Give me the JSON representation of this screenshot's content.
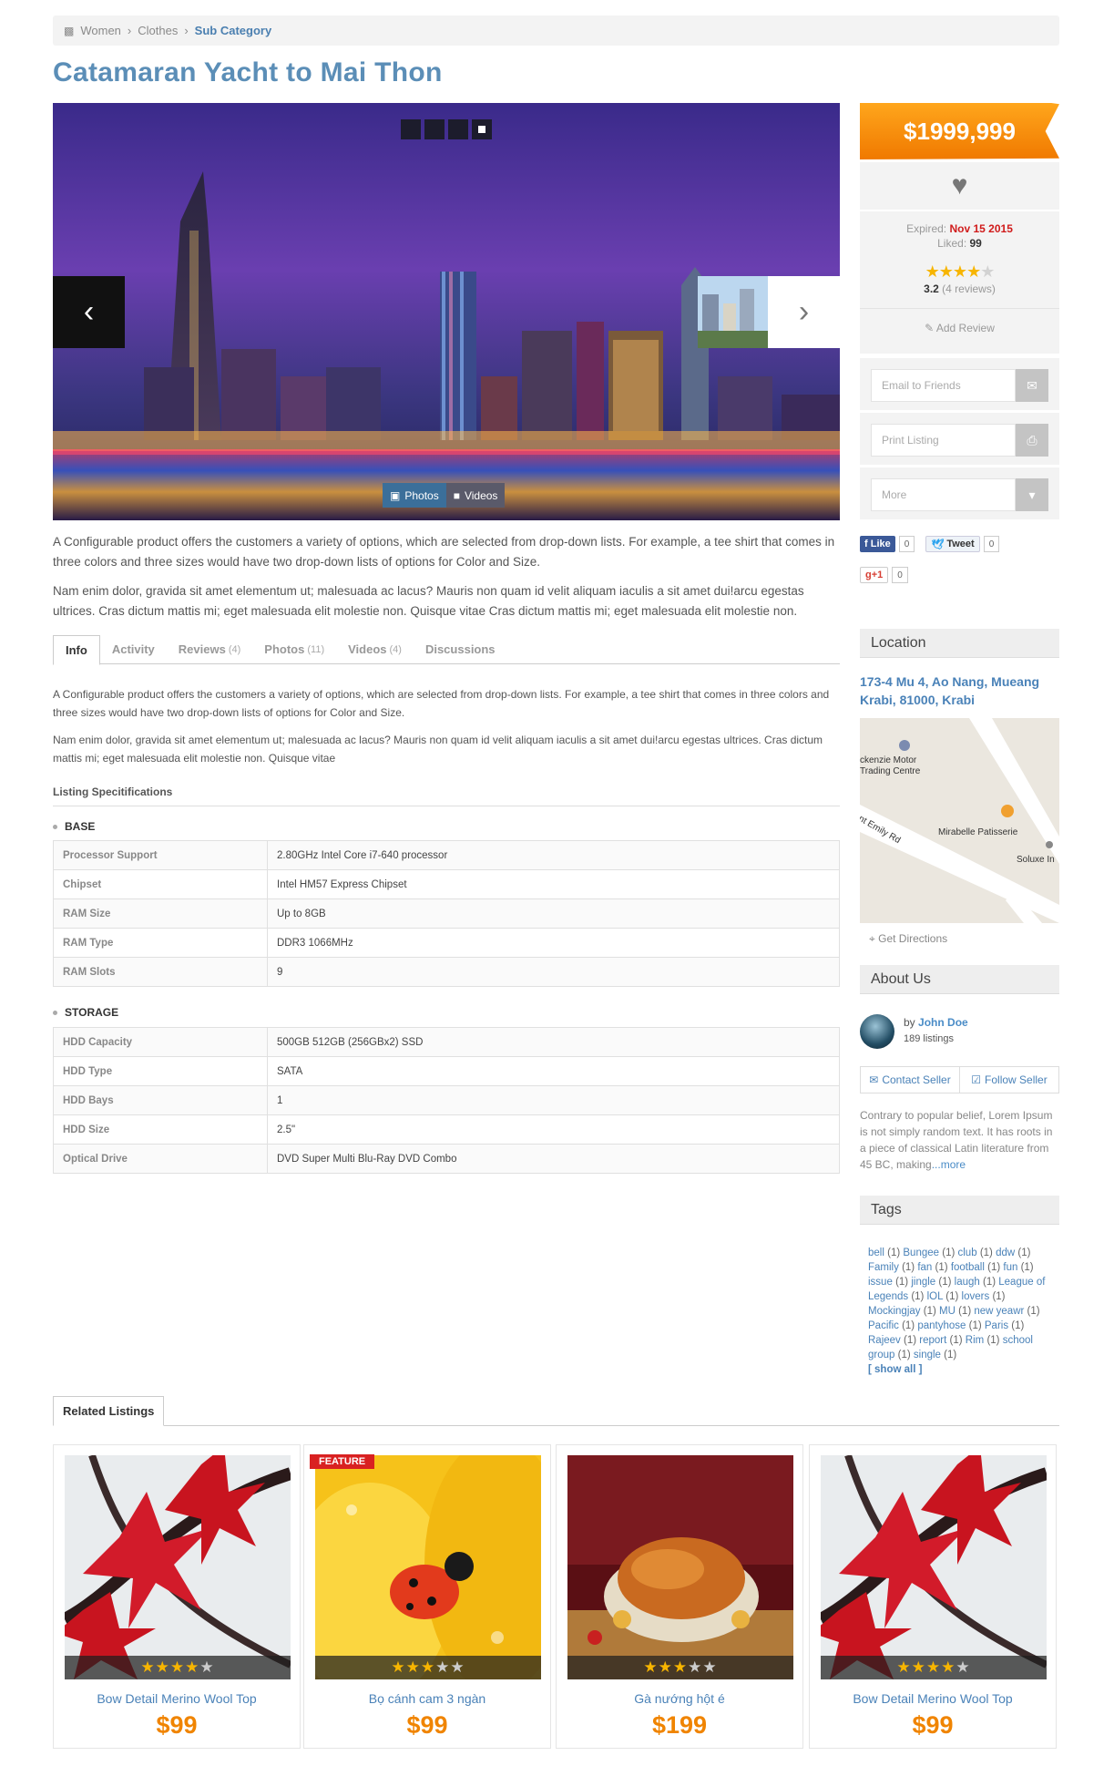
{
  "breadcrumb": {
    "items": [
      "Women",
      "Clothes"
    ],
    "current": "Sub Category"
  },
  "listing": {
    "title": "Catamaran Yacht to Mai Thon",
    "price": "$1999,999",
    "expired_label": "Expired:",
    "expired_value": "Nov 15 2015",
    "liked_label": "Liked:",
    "liked_value": "99",
    "rating": 3.2,
    "rating_text": "3.2",
    "reviews_text": "(4 reviews)",
    "add_review": "Add Review"
  },
  "slider": {
    "tabs": [
      {
        "label": "Photos",
        "icon": "photo-icon"
      },
      {
        "label": "Videos",
        "icon": "video-icon"
      }
    ]
  },
  "description": [
    "A Configurable product offers the customers a variety of options, which are selected from drop-down lists. For example, a tee shirt that comes in three colors and three sizes would have two drop-down lists of options for Color and Size.",
    "Nam enim dolor, gravida sit amet elementum ut; malesuada ac lacus? Mauris non quam id velit aliquam iaculis a sit amet dui!arcu egestas ultrices. Cras dictum mattis mi; eget malesuada elit molestie non. Quisque vitae Cras dictum mattis mi; eget malesuada elit molestie non."
  ],
  "tabs": [
    {
      "label": "Info",
      "count": ""
    },
    {
      "label": "Activity",
      "count": ""
    },
    {
      "label": "Reviews",
      "count": "(4)"
    },
    {
      "label": "Photos",
      "count": "(11)"
    },
    {
      "label": "Videos",
      "count": "(4)"
    },
    {
      "label": "Discussions",
      "count": ""
    }
  ],
  "info": {
    "paragraphs": [
      "A Configurable product offers the customers a variety of options, which are selected from drop-down lists. For example, a tee shirt that comes in three colors and three sizes would have two drop-down lists of options for Color and Size.",
      "Nam enim dolor, gravida sit amet elementum ut; malesuada ac lacus? Mauris non quam id velit aliquam iaculis a sit amet dui!arcu egestas ultrices. Cras dictum mattis mi; eget malesuada elit molestie non. Quisque vitae"
    ],
    "specs_title": "Listing Specitifications",
    "groups": [
      {
        "name": "BASE",
        "rows": [
          {
            "key": "Processor Support",
            "value": "2.80GHz Intel Core i7-640 processor"
          },
          {
            "key": "Chipset",
            "value": "Intel HM57 Express Chipset"
          },
          {
            "key": "RAM Size",
            "value": "Up to 8GB"
          },
          {
            "key": "RAM Type",
            "value": "DDR3 1066MHz"
          },
          {
            "key": "RAM Slots",
            "value": "9"
          }
        ]
      },
      {
        "name": "STORAGE",
        "rows": [
          {
            "key": "HDD Capacity",
            "value": "500GB 512GB (256GBx2) SSD"
          },
          {
            "key": "HDD Type",
            "value": "SATA"
          },
          {
            "key": "HDD Bays",
            "value": "1"
          },
          {
            "key": "HDD Size",
            "value": "2.5\""
          },
          {
            "key": "Optical Drive",
            "value": "DVD Super Multi Blu-Ray DVD Combo"
          }
        ]
      }
    ]
  },
  "actions": [
    {
      "label": "Email to Friends",
      "icon": "envelope-icon"
    },
    {
      "label": "Print Listing",
      "icon": "print-icon"
    },
    {
      "label": "More",
      "icon": "caret-down-icon"
    }
  ],
  "social": {
    "like": "Like",
    "like_count": "0",
    "tweet": "Tweet",
    "tweet_count": "0",
    "gplus": "g+1",
    "gplus_count": "0"
  },
  "location": {
    "heading": "Location",
    "address": "173-4 Mu 4, Ao Nang, Mueang Krabi, 81000, Krabi",
    "map_labels": [
      "ckenzie Motor Trading Centre",
      "nt Emily Rd",
      "Mirabelle Patisserie",
      "Soluxe In"
    ],
    "directions": "Get Directions"
  },
  "about": {
    "heading": "About Us",
    "by": "by",
    "name": "John Doe",
    "listings": "189 listings",
    "contact": "Contact Seller",
    "follow": "Follow Seller",
    "text": "Contrary to popular belief, Lorem Ipsum is not simply random text. It has roots in a piece of classical Latin literature from 45 BC, making",
    "more": "...more"
  },
  "tags": {
    "heading": "Tags",
    "items": [
      {
        "name": "bell",
        "count": "(1)"
      },
      {
        "name": "Bungee",
        "count": "(1)"
      },
      {
        "name": "club",
        "count": "(1)"
      },
      {
        "name": "ddw",
        "count": "(1)"
      },
      {
        "name": "Family",
        "count": "(1)"
      },
      {
        "name": "fan",
        "count": "(1)"
      },
      {
        "name": "football",
        "count": "(1)"
      },
      {
        "name": "fun",
        "count": "(1)"
      },
      {
        "name": "issue",
        "count": "(1)"
      },
      {
        "name": "jingle",
        "count": "(1)"
      },
      {
        "name": "laugh",
        "count": "(1)"
      },
      {
        "name": "League of Legends",
        "count": "(1)"
      },
      {
        "name": "lOL",
        "count": "(1)"
      },
      {
        "name": "lovers",
        "count": "(1)"
      },
      {
        "name": "Mockingjay",
        "count": "(1)"
      },
      {
        "name": "MU",
        "count": "(1)"
      },
      {
        "name": "new yeawr",
        "count": "(1)"
      },
      {
        "name": "Pacific",
        "count": "(1)"
      },
      {
        "name": "pantyhose",
        "count": "(1)"
      },
      {
        "name": "Paris",
        "count": "(1)"
      },
      {
        "name": "Rajeev",
        "count": "(1)"
      },
      {
        "name": "report",
        "count": "(1)"
      },
      {
        "name": "Rim",
        "count": "(1)"
      },
      {
        "name": "school group",
        "count": "(1)"
      },
      {
        "name": "single",
        "count": "(1)"
      }
    ],
    "show_all": "[ show all ]"
  },
  "related": {
    "tab": "Related Listings",
    "items": [
      {
        "name": "Bow Detail Merino Wool Top",
        "price": "$99",
        "rating": 4,
        "feature": "",
        "image": "red-leaves-image"
      },
      {
        "name": "Bọ cánh cam 3 ngàn",
        "price": "$99",
        "rating": 3,
        "feature": "FEATURE",
        "image": "ladybug-image"
      },
      {
        "name": "Gà nướng hột é",
        "price": "$199",
        "rating": 3,
        "feature": "",
        "image": "roast-chicken-image"
      },
      {
        "name": "Bow Detail Merino Wool Top",
        "price": "$99",
        "rating": 4,
        "feature": "",
        "image": "red-leaves-image"
      }
    ]
  },
  "colors": {
    "accent": "#f08400",
    "title": "#5b8eb7",
    "link": "#4a82b8",
    "red": "#d01b1b"
  }
}
